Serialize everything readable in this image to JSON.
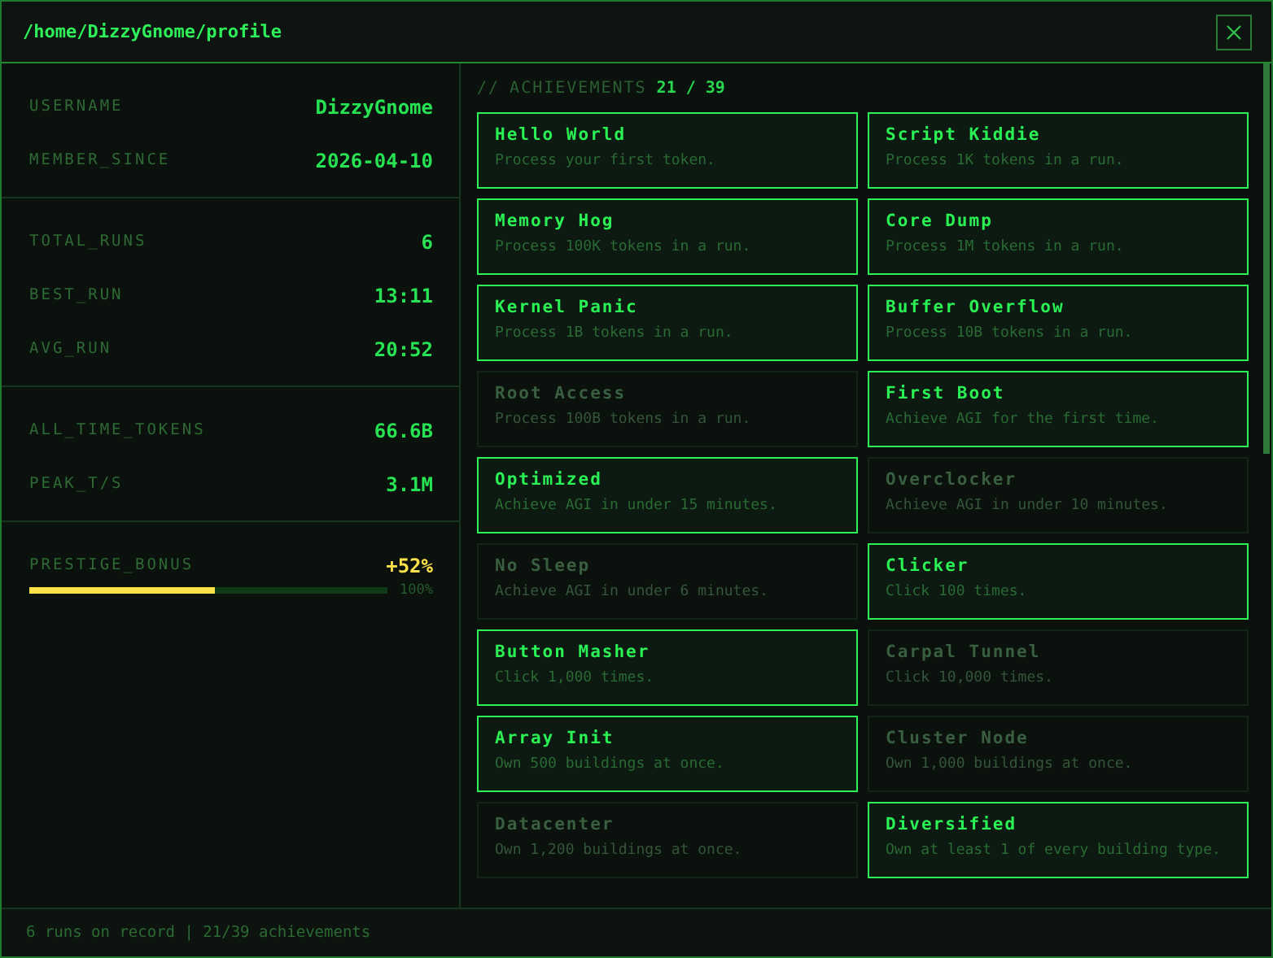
{
  "window": {
    "title": "/home/DizzyGnome/profile"
  },
  "stats": [
    {
      "items": [
        {
          "label": "USERNAME",
          "value": "DizzyGnome"
        },
        {
          "label": "MEMBER_SINCE",
          "value": "2026-04-10"
        }
      ]
    },
    {
      "items": [
        {
          "label": "TOTAL_RUNS",
          "value": "6"
        },
        {
          "label": "BEST_RUN",
          "value": "13:11"
        },
        {
          "label": "AVG_RUN",
          "value": "20:52"
        }
      ]
    },
    {
      "items": [
        {
          "label": "ALL_TIME_TOKENS",
          "value": "66.6B"
        },
        {
          "label": "PEAK_T/S",
          "value": "3.1M"
        }
      ]
    }
  ],
  "prestige": {
    "label": "PRESTIGE_BONUS",
    "value": "+52%",
    "level": 0.52,
    "max_label": "100%"
  },
  "achievements_header": {
    "prefix": "//",
    "title": "ACHIEVEMENTS",
    "count": "21 / 39"
  },
  "achievements": [
    {
      "name": "Hello World",
      "description": "Process your first token.",
      "unlocked": true
    },
    {
      "name": "Script Kiddie",
      "description": "Process 1K tokens in a run.",
      "unlocked": true
    },
    {
      "name": "Memory Hog",
      "description": "Process 100K tokens in a run.",
      "unlocked": true
    },
    {
      "name": "Core Dump",
      "description": "Process 1M tokens in a run.",
      "unlocked": true
    },
    {
      "name": "Kernel Panic",
      "description": "Process 1B tokens in a run.",
      "unlocked": true
    },
    {
      "name": "Buffer Overflow",
      "description": "Process 10B tokens in a run.",
      "unlocked": true
    },
    {
      "name": "Root Access",
      "description": "Process 100B tokens in a run.",
      "unlocked": false
    },
    {
      "name": "First Boot",
      "description": "Achieve AGI for the first time.",
      "unlocked": true
    },
    {
      "name": "Optimized",
      "description": "Achieve AGI in under 15 minutes.",
      "unlocked": true
    },
    {
      "name": "Overclocker",
      "description": "Achieve AGI in under 10 minutes.",
      "unlocked": false
    },
    {
      "name": "No Sleep",
      "description": "Achieve AGI in under 6 minutes.",
      "unlocked": false
    },
    {
      "name": "Clicker",
      "description": "Click 100 times.",
      "unlocked": true
    },
    {
      "name": "Button Masher",
      "description": "Click 1,000 times.",
      "unlocked": true
    },
    {
      "name": "Carpal Tunnel",
      "description": "Click 10,000 times.",
      "unlocked": false
    },
    {
      "name": "Array Init",
      "description": "Own 500 buildings at once.",
      "unlocked": true
    },
    {
      "name": "Cluster Node",
      "description": "Own 1,000 buildings at once.",
      "unlocked": false
    },
    {
      "name": "Datacenter",
      "description": "Own 1,200 buildings at once.",
      "unlocked": false
    },
    {
      "name": "Diversified",
      "description": "Own at least 1 of every building type.",
      "unlocked": true
    }
  ],
  "status_bar": "6 runs on record | 21/39 achievements"
}
